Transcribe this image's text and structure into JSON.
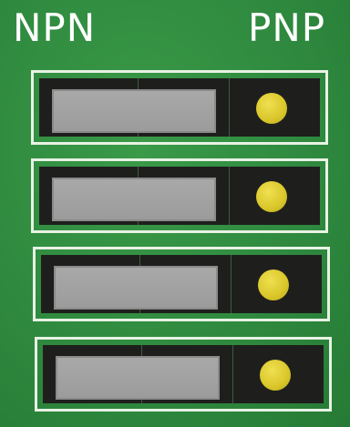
{
  "board": {
    "left_label": "NPN",
    "right_label": "PNP",
    "colors": {
      "pcb_green": "#2f8a3f",
      "silkscreen": "#ffffff",
      "socket_body": "#1e1f1d",
      "lcd_grey": "#a3a3a3",
      "led_yellow": "#e0cc30"
    }
  },
  "slots": [
    {
      "display_icon": "lcd-display",
      "indicator_icon": "yellow-led-icon"
    },
    {
      "display_icon": "lcd-display",
      "indicator_icon": "yellow-led-icon"
    },
    {
      "display_icon": "lcd-display",
      "indicator_icon": "yellow-led-icon"
    },
    {
      "display_icon": "lcd-display",
      "indicator_icon": "yellow-led-icon"
    }
  ]
}
